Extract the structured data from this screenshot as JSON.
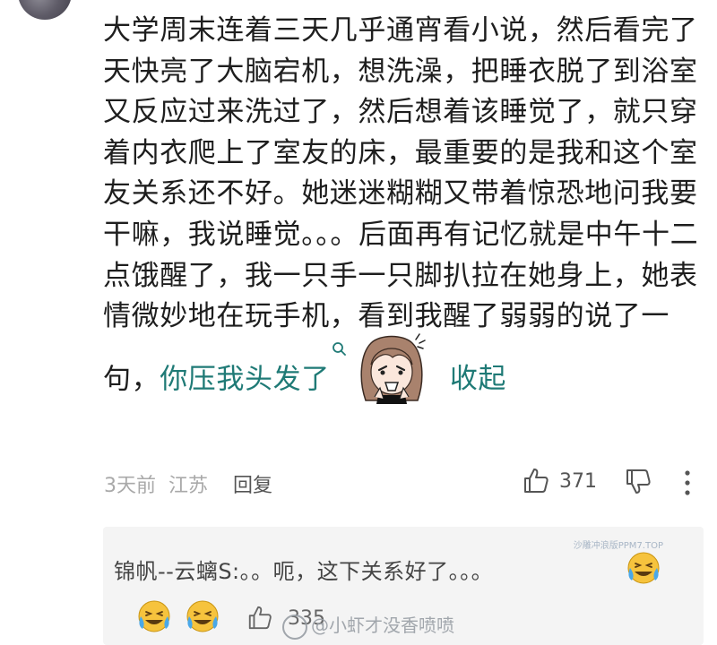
{
  "comment": {
    "text_main": "大学周末连着三天几乎通宵看小说，然后看完了天快亮了大脑宕机，想洗澡，把睡衣脱了到浴室又反应过来洗过了，然后想着该睡觉了，就只穿着内衣爬上了室友的床，最重要的是我和这个室友关系还不好。她迷迷糊糊又带着惊恐地问我要干嘛，我说睡觉。。。后面再有记忆就是中午十二点饿醒了，我一只手一只脚扒拉在她身上，她表情微妙地在玩手机，看到我醒了弱弱的说了一句，",
    "highlight": "你压我头发了",
    "search_icon": "search-icon",
    "sticker_icon": "anime-girl-sticker-icon",
    "expand_label": "收起"
  },
  "meta": {
    "date": "3天前",
    "location": "江苏",
    "reply_label": "回复",
    "like_count": "371"
  },
  "reply": {
    "text": "锦帆--云螭S:。。呃，这下关系好了。。。",
    "emoji_icon": "crying-laughing-emoji",
    "like_count": "335"
  },
  "watermarks": {
    "top": "沙雕冲浪版PPM7.TOP",
    "main": "@小虾才没香喷喷"
  },
  "colors": {
    "highlight": "#1f7a76",
    "meta_gray": "#a9a9a9",
    "reply_bg": "#f4f4f4",
    "emoji_yellow": "#f6c33d"
  }
}
